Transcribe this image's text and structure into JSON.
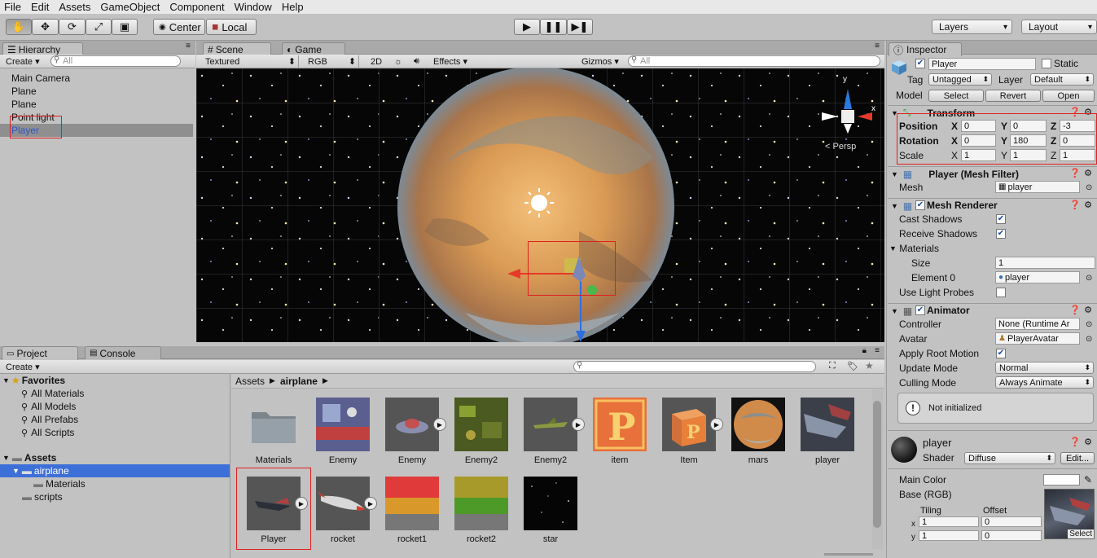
{
  "menu": [
    "File",
    "Edit",
    "Assets",
    "GameObject",
    "Component",
    "Window",
    "Help"
  ],
  "toolbar": {
    "pivot": "Center",
    "space": "Local",
    "layers": "Layers",
    "layout": "Layout"
  },
  "hierarchy": {
    "tab": "Hierarchy",
    "create": "Create",
    "search_placeholder": "All",
    "items": [
      "Main Camera",
      "Plane",
      "Plane",
      "Point light",
      "Player"
    ]
  },
  "scene": {
    "tab_scene": "Scene",
    "tab_game": "Game",
    "render_mode": "Textured",
    "color_mode": "RGB",
    "mode_2d": "2D",
    "effects": "Effects",
    "gizmos": "Gizmos",
    "search_placeholder": "All",
    "persp": "Persp",
    "axis_x": "x",
    "axis_y": "y"
  },
  "inspector": {
    "tab": "Inspector",
    "name": "Player",
    "static": "Static",
    "tag_label": "Tag",
    "tag": "Untagged",
    "layer_label": "Layer",
    "layer": "Default",
    "model_label": "Model",
    "model_select": "Select",
    "model_revert": "Revert",
    "model_open": "Open",
    "transform": {
      "title": "Transform",
      "position_label": "Position",
      "rotation_label": "Rotation",
      "scale_label": "Scale",
      "position": {
        "x": "0",
        "y": "0",
        "z": "-3"
      },
      "rotation": {
        "x": "0",
        "y": "180",
        "z": "0"
      },
      "scale": {
        "x": "1",
        "y": "1",
        "z": "1"
      }
    },
    "mesh_filter": {
      "title": "Player (Mesh Filter)",
      "mesh_label": "Mesh",
      "mesh": "player"
    },
    "mesh_renderer": {
      "title": "Mesh Renderer",
      "cast_shadows": "Cast Shadows",
      "receive_shadows": "Receive Shadows",
      "materials": "Materials",
      "size_label": "Size",
      "size": "1",
      "element0_label": "Element 0",
      "element0": "player",
      "use_light_probes": "Use Light Probes"
    },
    "animator": {
      "title": "Animator",
      "controller_label": "Controller",
      "controller": "None (Runtime Ar",
      "avatar_label": "Avatar",
      "avatar": "PlayerAvatar",
      "apply_root_motion": "Apply Root Motion",
      "update_mode_label": "Update Mode",
      "update_mode": "Normal",
      "culling_mode_label": "Culling Mode",
      "culling_mode": "Always Animate",
      "notice": "Not initialized"
    },
    "material": {
      "name": "player",
      "shader_label": "Shader",
      "shader": "Diffuse",
      "edit": "Edit...",
      "main_color": "Main Color",
      "base": "Base (RGB)",
      "tiling": "Tiling",
      "offset": "Offset",
      "x_label": "x",
      "y_label": "y",
      "tiling_x": "1",
      "tiling_y": "1",
      "offset_x": "0",
      "offset_y": "0",
      "select": "Select"
    }
  },
  "project": {
    "tab_project": "Project",
    "tab_console": "Console",
    "create": "Create",
    "favorites": "Favorites",
    "fav_items": [
      "All Materials",
      "All Models",
      "All Prefabs",
      "All Scripts"
    ],
    "assets": "Assets",
    "folders": [
      "airplane",
      "Materials",
      "scripts"
    ],
    "breadcrumb_root": "Assets",
    "breadcrumb_current": "airplane",
    "grid": [
      "Materials",
      "Enemy",
      "Enemy",
      "Enemy2",
      "Enemy2",
      "item",
      "Item",
      "mars",
      "player",
      "Player",
      "rocket",
      "rocket1",
      "rocket2",
      "star"
    ]
  },
  "colors": {
    "selection_blue": "#3d6fd8",
    "highlight_red": "#e02020",
    "panel_gray": "#c2c2c2"
  }
}
